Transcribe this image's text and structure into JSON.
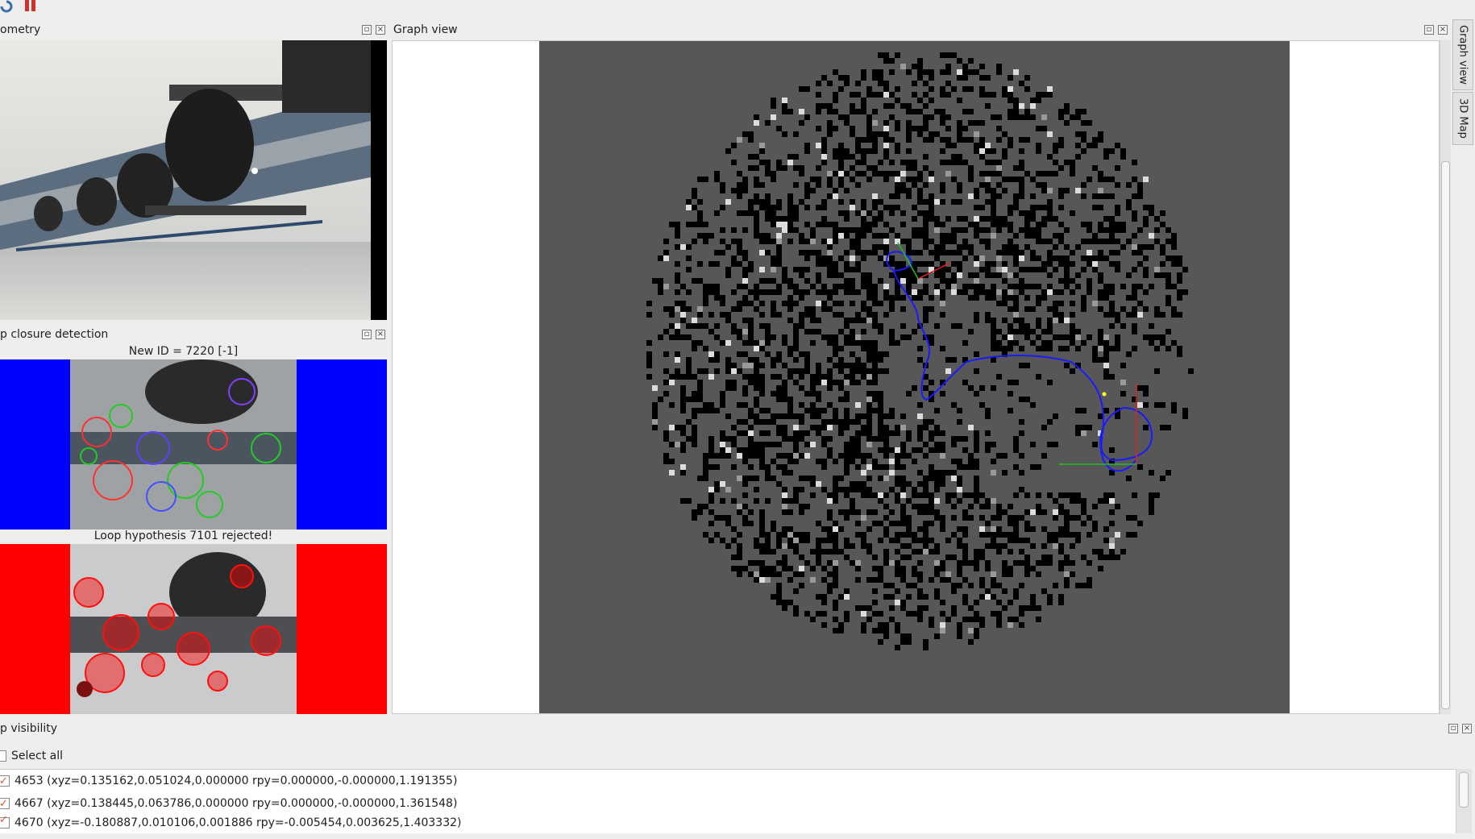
{
  "toolbar": {
    "buttons": [
      {
        "icon": "refresh-icon"
      },
      {
        "icon": "pause-icon"
      }
    ]
  },
  "odometry_panel": {
    "title": "ometry"
  },
  "loop_panel": {
    "title": "p closure detection",
    "caption_top": "New ID = 7220 [-1]",
    "caption_bottom": "Loop hypothesis 7101 rejected!",
    "colors": {
      "accepted": "#0000ff",
      "rejected": "#ff0000"
    }
  },
  "graph_panel": {
    "title": "Graph view",
    "colors": {
      "map_bg": "#575757",
      "obstacle": "#000000",
      "trajectory": "#1a1aff"
    }
  },
  "side_tabs": [
    {
      "label": "Graph view"
    },
    {
      "label": "3D Map"
    }
  ],
  "visibility_panel": {
    "title": "p visibility",
    "select_all": "Select all",
    "rows": [
      {
        "label": "4653 (xyz=0.135162,0.051024,0.000000 rpy=0.000000,-0.000000,1.191355)",
        "checked": true
      },
      {
        "label": "4667 (xyz=0.138445,0.063786,0.000000 rpy=0.000000,-0.000000,1.361548)",
        "checked": true
      },
      {
        "label": "4670 (xyz=-0.180887,0.010106,0.001886 rpy=-0.005454,0.003625,1.403332)",
        "checked": true
      }
    ]
  }
}
